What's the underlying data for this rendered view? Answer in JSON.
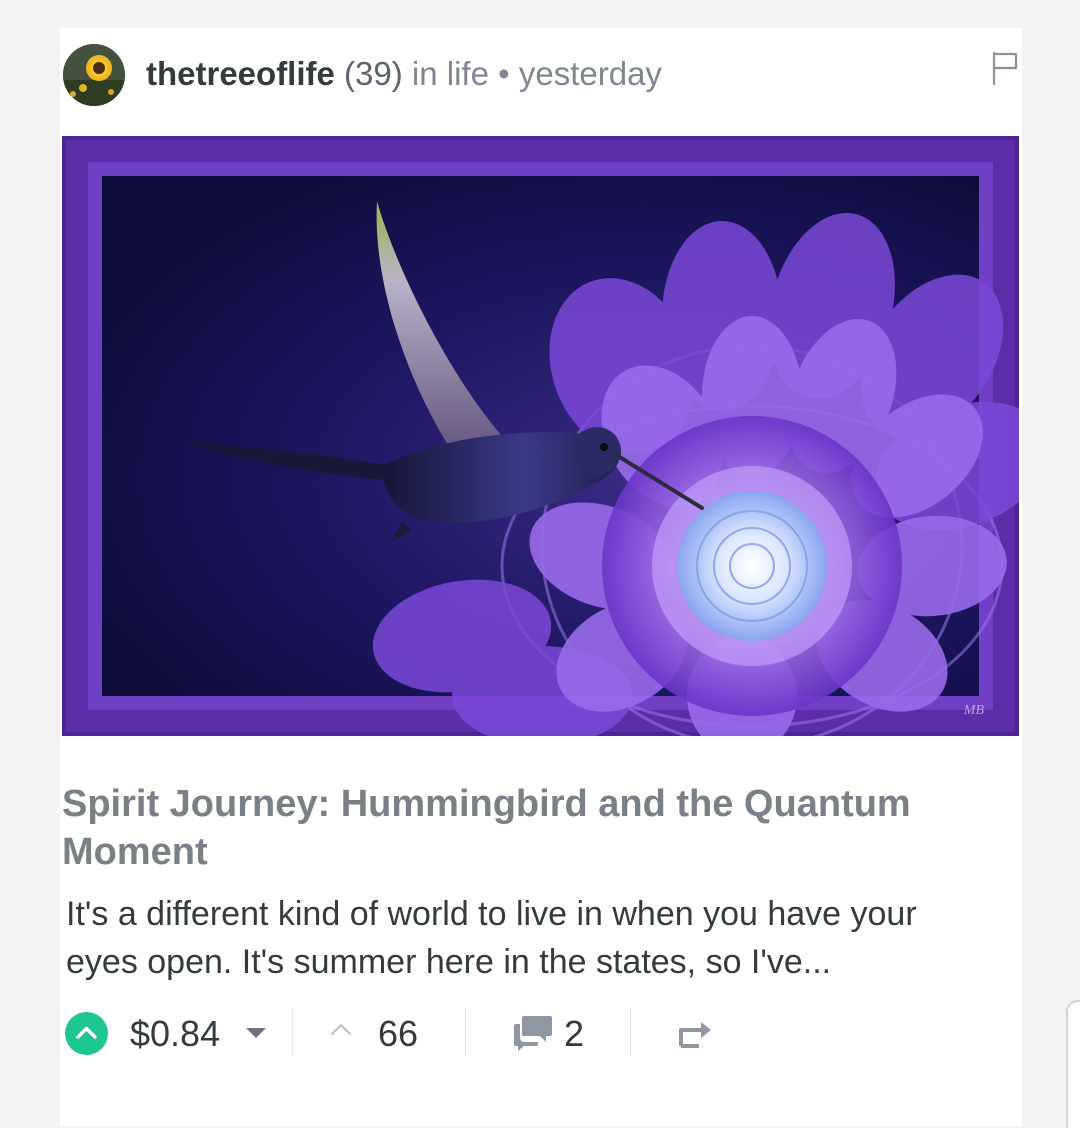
{
  "post": {
    "author": "thetreeoflife",
    "reputation": "(39)",
    "category": "in life",
    "separator": "•",
    "time": "yesterday",
    "title": "Spirit Journey: Hummingbird and the Quantum Moment",
    "excerpt": "It's a different kind of world to live in when you have your eyes open. It's summer here in the states, so I've...",
    "image_signature": "MB"
  },
  "footer": {
    "payout": "$0.84",
    "votes": "66",
    "comments": "2"
  },
  "icons": {
    "flag": "flag-icon",
    "upvote": "upvote-chevron-icon",
    "payout_dropdown": "caret-down-icon",
    "votes": "chevron-up-icon",
    "comments": "comment-bubbles-icon",
    "resteem": "resteem-arrow-icon"
  },
  "colors": {
    "upvote_accent": "#1ec792",
    "title": "#7a8088",
    "text": "#333a40",
    "muted": "#7d8794",
    "image_frame": "#5b2ea8"
  }
}
